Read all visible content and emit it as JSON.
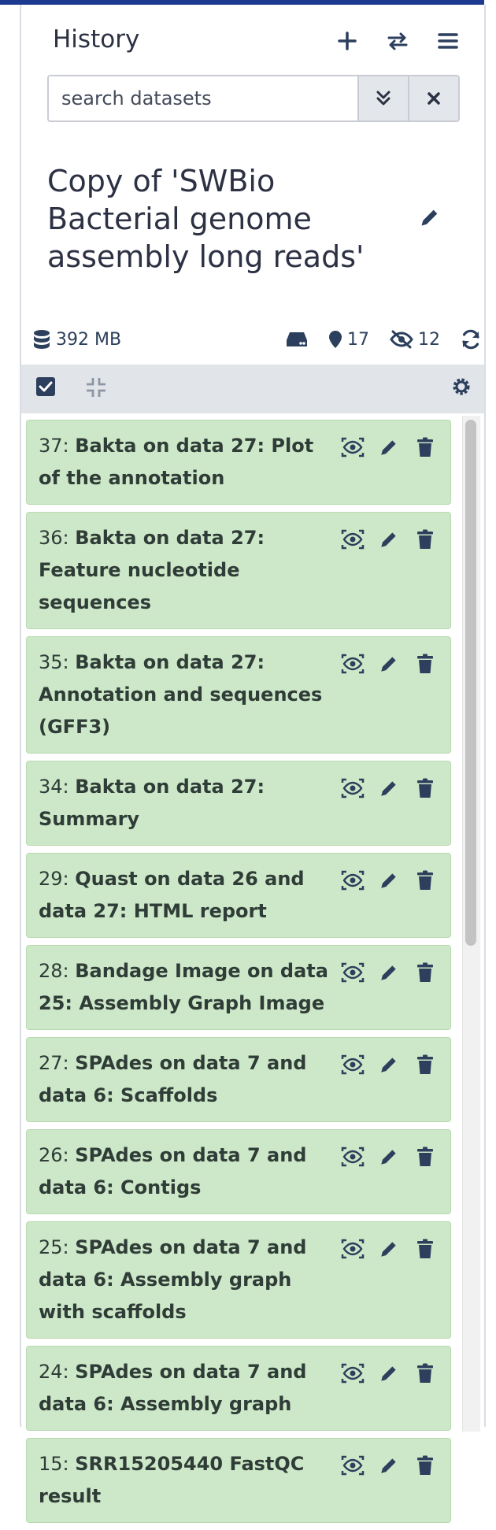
{
  "header": {
    "title": "History"
  },
  "search": {
    "placeholder": "search datasets"
  },
  "history": {
    "name": "Copy of 'SWBio Bacterial genome assembly long reads'"
  },
  "stats": {
    "size": "392 MB",
    "shown": "17",
    "hidden": "12"
  },
  "datasets": [
    {
      "hid": "37:",
      "name": "Bakta on data 27: Plot of the annotation"
    },
    {
      "hid": "36:",
      "name": "Bakta on data 27: Feature nucleotide sequences"
    },
    {
      "hid": "35:",
      "name": "Bakta on data 27: Annotation and sequences (GFF3)"
    },
    {
      "hid": "34:",
      "name": "Bakta on data 27: Summary"
    },
    {
      "hid": "29:",
      "name": "Quast on data 26 and data 27: HTML report"
    },
    {
      "hid": "28:",
      "name": "Bandage Image on data 25: Assembly Graph Image"
    },
    {
      "hid": "27:",
      "name": "SPAdes on data 7 and data 6: Scaffolds"
    },
    {
      "hid": "26:",
      "name": "SPAdes on data 7 and data 6: Contigs"
    },
    {
      "hid": "25:",
      "name": "SPAdes on data 7 and data 6: Assembly graph with scaffolds"
    },
    {
      "hid": "24:",
      "name": "SPAdes on data 7 and data 6: Assembly graph"
    },
    {
      "hid": "15:",
      "name": "SRR15205440 FastQC result"
    }
  ],
  "colors": {
    "accent": "#1c3a8f",
    "item_bg": "#cde8c8",
    "icon": "#2c3f5c"
  }
}
